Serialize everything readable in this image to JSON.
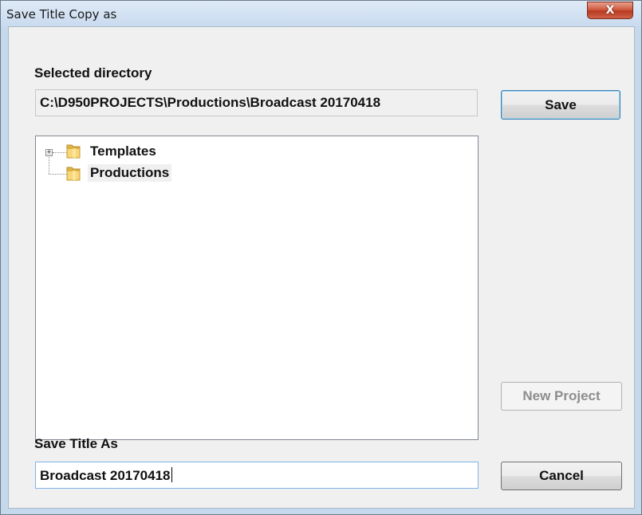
{
  "window": {
    "title": "Save Title Copy as",
    "close_label": "X"
  },
  "directory": {
    "label": "Selected directory",
    "value": "C:\\D950PROJECTS\\Productions\\Broadcast 20170418"
  },
  "tree": {
    "items": [
      {
        "label": "Templates",
        "expandable": true,
        "selected": false,
        "icon": "folder-icon"
      },
      {
        "label": "Productions",
        "expandable": false,
        "selected": true,
        "icon": "folder-icon"
      }
    ],
    "expander_glyph": "+"
  },
  "save_as": {
    "label": "Save Title As",
    "value": "Broadcast 20170418"
  },
  "buttons": {
    "save": "Save",
    "new_project": "New Project",
    "cancel": "Cancel"
  }
}
